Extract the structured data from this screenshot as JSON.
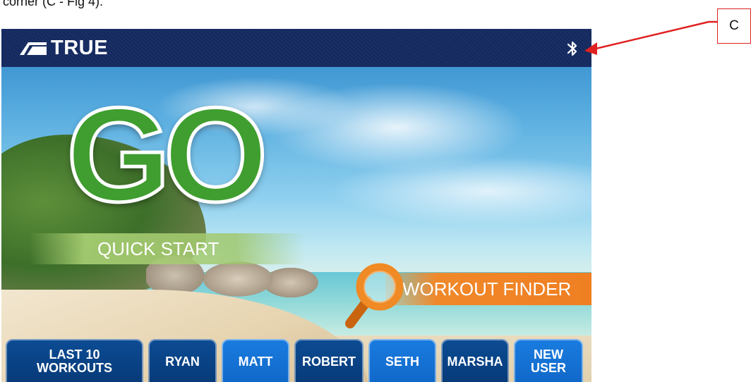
{
  "document": {
    "top_text": "corner (C - Fig 4)."
  },
  "header": {
    "brand": "TRUE",
    "bluetooth_icon": "bluetooth-icon"
  },
  "main": {
    "go_label": "GO",
    "quick_start_label": "QUICK START",
    "workout_finder_label": "WORKOUT FINDER"
  },
  "user_bar": {
    "buttons": [
      {
        "label": "LAST 10\nWORKOUTS",
        "style": "dark"
      },
      {
        "label": "RYAN",
        "style": "dark"
      },
      {
        "label": "MATT",
        "style": "light"
      },
      {
        "label": "ROBERT",
        "style": "dark"
      },
      {
        "label": "SETH",
        "style": "light"
      },
      {
        "label": "MARSHA",
        "style": "dark"
      },
      {
        "label": "NEW\nUSER",
        "style": "light"
      }
    ]
  },
  "callout": {
    "label": "C",
    "color": "#e02020"
  },
  "colors": {
    "header": "#14285a",
    "go_green": "#3f9e2f",
    "workout_orange": "#ef7f22",
    "button_dark": "#073a78",
    "button_light": "#1068c8"
  }
}
